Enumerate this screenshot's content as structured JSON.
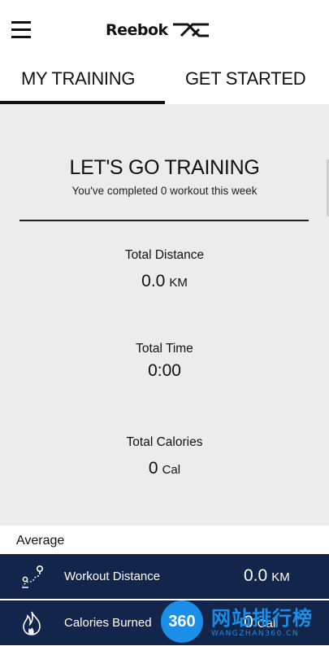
{
  "header": {
    "logo_text": "Reebok",
    "logo_icon": "reebok-vector-icon",
    "menu_icon": "hamburger-menu-icon"
  },
  "tabs": [
    {
      "label": "MY TRAINING",
      "active": true
    },
    {
      "label": "GET STARTED",
      "active": false
    }
  ],
  "summary": {
    "title": "LET'S GO TRAINING",
    "subtitle": "You've completed 0 workout this week"
  },
  "stats": [
    {
      "label": "Total Distance",
      "value": "0.0",
      "unit": "KM"
    },
    {
      "label": "Total Time",
      "value": "0:00",
      "unit": ""
    },
    {
      "label": "Total Calories",
      "value": "0",
      "unit": "Cal"
    }
  ],
  "average": {
    "label": "Average",
    "rows": [
      {
        "label": "Workout Distance",
        "value": "0.0",
        "unit": "KM",
        "icon": "route-icon"
      },
      {
        "label": "Calories Burned",
        "value": "0",
        "unit": "Cal",
        "icon": "flame-icon"
      }
    ]
  },
  "watermark": {
    "badge": "360",
    "text": "网站排行榜",
    "subtext": "WANGZHAN360.CN"
  },
  "colors": {
    "row_background": "#13254a",
    "panel_background": "#ececec",
    "watermark": "#1b8fe8"
  }
}
